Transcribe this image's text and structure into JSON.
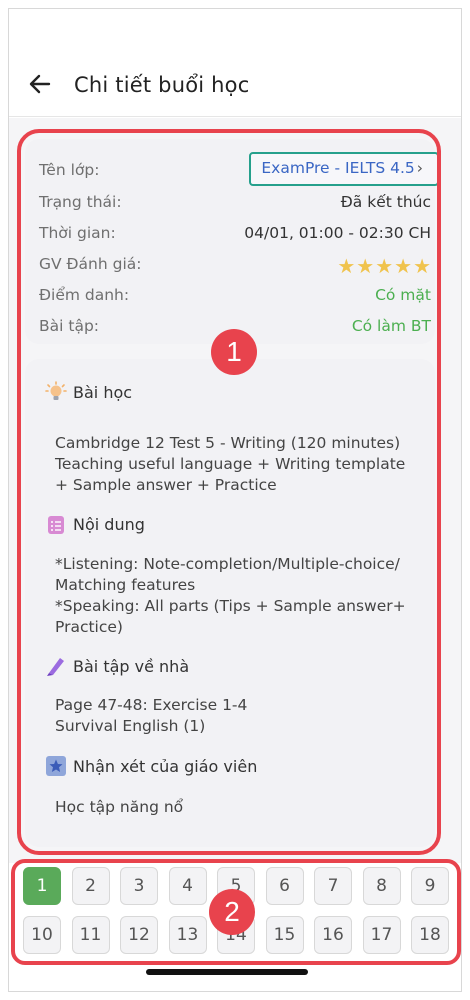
{
  "header": {
    "title": "Chi tiết buổi học"
  },
  "info": {
    "class_label": "Tên lớp:",
    "class_value": "ExamPre - IELTS 4.5",
    "status_label": "Trạng thái:",
    "status_value": "Đã kết thúc",
    "time_label": "Thời gian:",
    "time_value": "04/01, 01:00 - 02:30 CH",
    "rating_label": "GV Đánh giá:",
    "rating_stars": 5,
    "attendance_label": "Điểm danh:",
    "attendance_value": "Có mặt",
    "homework_label": "Bài tập:",
    "homework_value": "Có làm BT",
    "green": "#4caf50",
    "link_color": "#3a66c4"
  },
  "sections": {
    "lesson_title": "Bài học",
    "lesson_body": "Cambridge 12 Test 5 - Writing (120 minutes)\nTeaching useful language + Writing template\n+ Sample answer + Practice",
    "content_title": "Nội dung",
    "content_body": "*Listening: Note-completion/Multiple-choice/\nMatching features\n*Speaking: All parts (Tips + Sample answer+\nPractice)",
    "homework_title": "Bài tập về nhà",
    "homework_body": "Page 47-48: Exercise 1-4\n Survival English (1)",
    "feedback_title": "Nhận xét của giáo viên",
    "feedback_body": "Học tập năng nổ"
  },
  "annotations": {
    "badge_1": "1",
    "badge_2": "2",
    "color": "#e8434d"
  },
  "pager": {
    "row1": [
      "1",
      "2",
      "3",
      "4",
      "5",
      "6",
      "7",
      "8",
      "9"
    ],
    "row2": [
      "10",
      "11",
      "12",
      "13",
      "14",
      "15",
      "16",
      "17",
      "18"
    ],
    "active": "1"
  }
}
